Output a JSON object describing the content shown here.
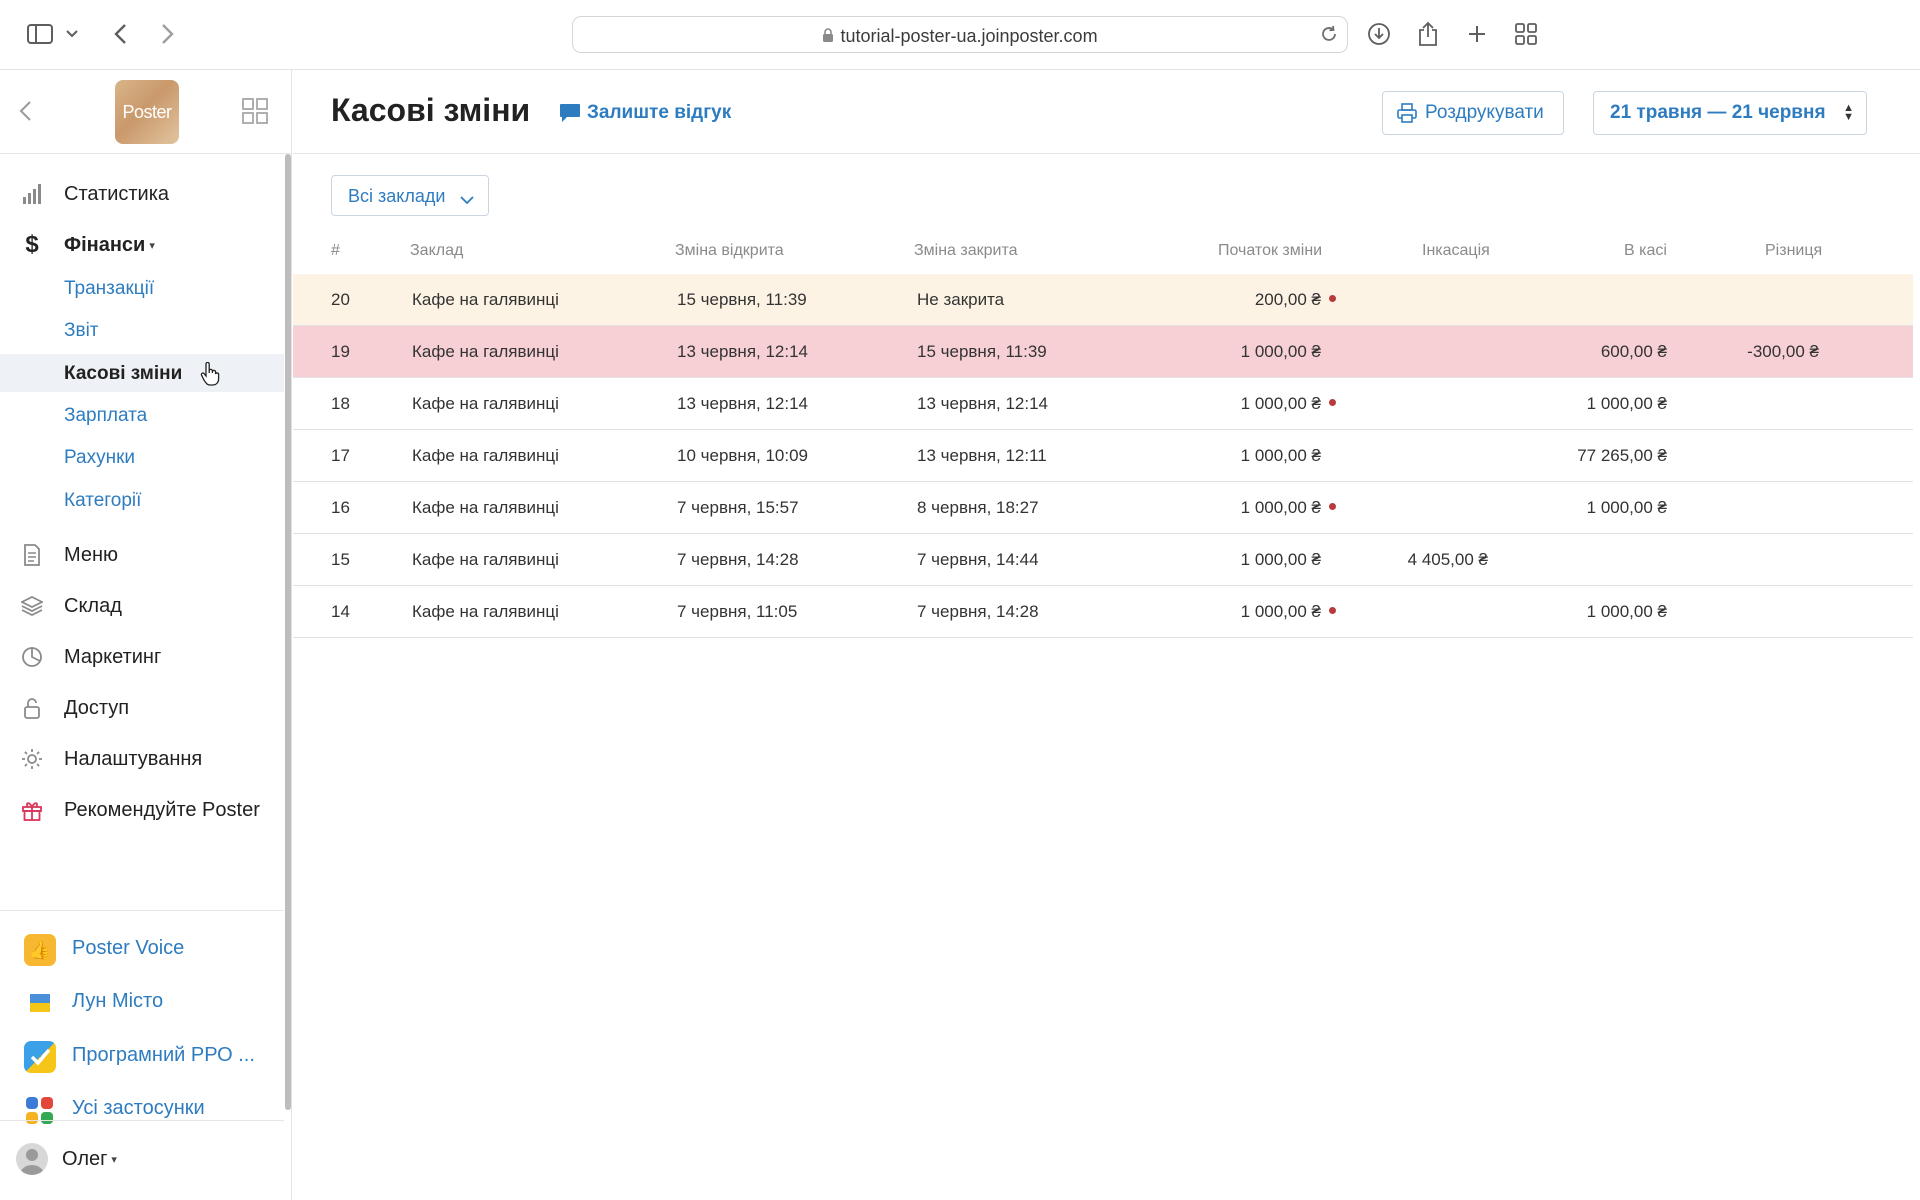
{
  "browser": {
    "url": "tutorial-poster-ua.joinposter.com"
  },
  "sidebar": {
    "logo_text": "Poster",
    "nav": {
      "statistics": "Статистика",
      "finance": "Фінанси",
      "finance_sub": [
        "Транзакції",
        "Звіт",
        "Касові зміни",
        "Зарплата",
        "Рахунки",
        "Категорії"
      ],
      "menu": "Меню",
      "warehouse": "Склад",
      "marketing": "Маркетинг",
      "access": "Доступ",
      "settings": "Налаштування",
      "recommend": "Рекомендуйте Poster"
    },
    "apps": [
      "Poster Voice",
      "Лун Місто",
      "Програмний РРО ...",
      "Усі застосунки"
    ],
    "user": "Олег"
  },
  "header": {
    "title": "Касові зміни",
    "feedback": "Залиште відгук",
    "print": "Роздрукувати",
    "date_range": "21 травня — 21 червня"
  },
  "filter": {
    "selected": "Всі заклади"
  },
  "table": {
    "columns": [
      "#",
      "Заклад",
      "Зміна відкрита",
      "Зміна закрита",
      "Початок зміни",
      "Інкасація",
      "В касі",
      "Різниця"
    ],
    "rows": [
      {
        "id": "20",
        "place": "Кафе на галявинці",
        "opened": "15 червня, 11:39",
        "closed": "Не закрита",
        "start": "200,00 ₴",
        "start_flag": true,
        "collection": "",
        "in_cash": "",
        "diff": "",
        "highlight": "open"
      },
      {
        "id": "19",
        "place": "Кафе на галявинці",
        "opened": "13 червня, 12:14",
        "closed": "15 червня, 11:39",
        "start": "1 000,00 ₴",
        "start_flag": false,
        "collection": "",
        "in_cash": "600,00 ₴",
        "diff": "-300,00 ₴",
        "highlight": "error"
      },
      {
        "id": "18",
        "place": "Кафе на галявинці",
        "opened": "13 червня, 12:14",
        "closed": "13 червня, 12:14",
        "start": "1 000,00 ₴",
        "start_flag": true,
        "collection": "",
        "in_cash": "1 000,00 ₴",
        "diff": "",
        "highlight": ""
      },
      {
        "id": "17",
        "place": "Кафе на галявинці",
        "opened": "10 червня, 10:09",
        "closed": "13 червня, 12:11",
        "start": "1 000,00 ₴",
        "start_flag": false,
        "collection": "",
        "in_cash": "77 265,00 ₴",
        "diff": "",
        "highlight": ""
      },
      {
        "id": "16",
        "place": "Кафе на галявинці",
        "opened": "7 червня, 15:57",
        "closed": "8 червня, 18:27",
        "start": "1 000,00 ₴",
        "start_flag": true,
        "collection": "",
        "in_cash": "1 000,00 ₴",
        "diff": "",
        "highlight": ""
      },
      {
        "id": "15",
        "place": "Кафе на галявинці",
        "opened": "7 червня, 14:28",
        "closed": "7 червня, 14:44",
        "start": "1 000,00 ₴",
        "start_flag": false,
        "collection": "4 405,00 ₴",
        "in_cash": "",
        "diff": "",
        "highlight": ""
      },
      {
        "id": "14",
        "place": "Кафе на галявинці",
        "opened": "7 червня, 11:05",
        "closed": "7 червня, 14:28",
        "start": "1 000,00 ₴",
        "start_flag": true,
        "collection": "",
        "in_cash": "1 000,00 ₴",
        "diff": "",
        "highlight": ""
      }
    ]
  },
  "colors": {
    "accent": "#2e7cc0",
    "row_open": "#fdf3e5",
    "row_error": "#f7d0d6",
    "flag_dot": "#b83a3a"
  }
}
